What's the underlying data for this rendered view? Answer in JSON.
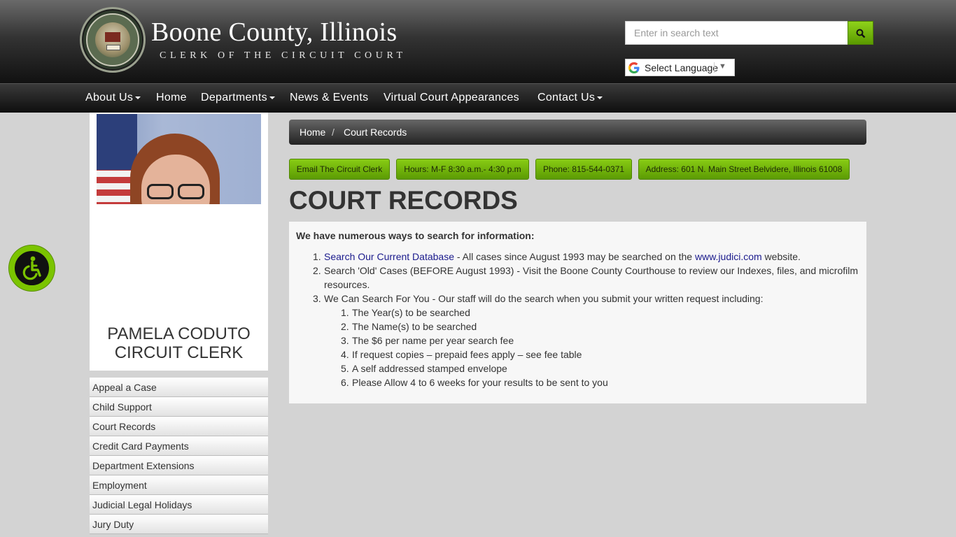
{
  "header": {
    "title": "Boone County, Illinois",
    "subtitle": "CLERK OF THE CIRCUIT COURT",
    "seal_text": "BOONE COUNTY ILLINOIS 1837",
    "search_placeholder": "Enter in search text",
    "language_label": "Select Language"
  },
  "nav": {
    "items": [
      "About Us",
      "Home",
      "Departments",
      "News & Events",
      "Virtual Court Appearances",
      "Contact Us"
    ]
  },
  "sidebar": {
    "name": "PAMELA CODUTO",
    "role": "CIRCUIT CLERK",
    "links": [
      "Appeal a Case",
      "Child Support",
      "Court Records",
      "Credit Card Payments",
      "Department Extensions",
      "Employment",
      "Judicial Legal Holidays",
      "Jury Duty"
    ]
  },
  "breadcrumb": {
    "home": "Home",
    "separator": "/",
    "current": "Court Records"
  },
  "info_buttons": [
    "Email The Circuit Clerk",
    "Hours: M-F 8:30 a.m.- 4:30 p.m",
    "Phone: 815-544-0371",
    "Address: 601 N. Main Street Belvidere, Illinois 61008"
  ],
  "main": {
    "title": "COURT RECORDS",
    "intro": "We have numerous ways to search for information:",
    "items": [
      {
        "num": "1.",
        "link": "Search Our Current Database",
        "text": " - All cases since August 1993 may be searched on the ",
        "link2": "www.judici.com",
        "text2": " website."
      },
      {
        "num": "2.",
        "line1": "Search 'Old' Cases (BEFORE August 1993) - Visit the Boone County Courthouse to review our Indexes, files, and microfilm",
        "line2": "resources."
      },
      {
        "num": "3.",
        "text": "We Can Search For You - Our staff will do the search when you submit your written request including:",
        "sub": [
          "The Year(s) to be searched",
          "The Name(s) to be searched",
          "The $6 per name per year search fee",
          "If request copies – prepaid fees apply – see fee table",
          "A self addressed stamped envelope",
          "Please Allow 4 to 6 weeks for your results to be sent to you"
        ]
      }
    ]
  },
  "colors": {
    "accent_green": "#7bc400",
    "header_dark": "#111111",
    "page_bg": "#d3d3d3"
  }
}
